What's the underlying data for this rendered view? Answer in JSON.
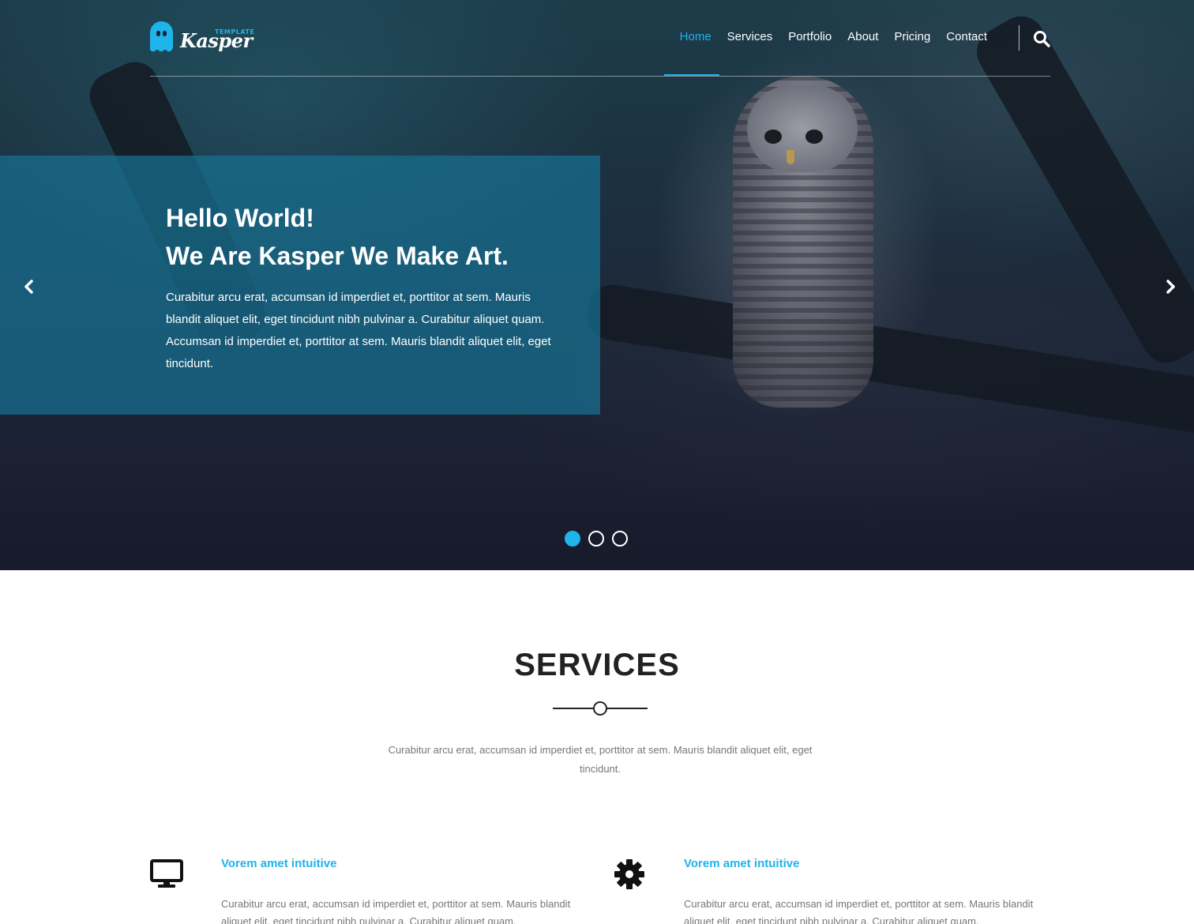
{
  "logo": {
    "small": "TEMPLATE",
    "word": "Kasper"
  },
  "nav": {
    "items": [
      "Home",
      "Services",
      "Portfolio",
      "About",
      "Pricing",
      "Contact"
    ],
    "active": "Home"
  },
  "icons": {
    "search": "search-icon",
    "prev": "chevron-left-icon",
    "next": "chevron-right-icon",
    "service1": "desktop-icon",
    "service2": "gear-icon"
  },
  "colors": {
    "accent": "#1fb4ea",
    "hero_box": "#187091",
    "heading": "#222222",
    "body_text": "#777777"
  },
  "hero": {
    "title": "Hello World!\nWe Are Kasper We Make Art.",
    "text": "Curabitur arcu erat, accumsan id imperdiet et, porttitor at sem. Mauris blandit aliquet elit, eget tincidunt nibh pulvinar a. Curabitur aliquet quam. Accumsan id imperdiet et, porttitor at sem. Mauris blandit aliquet elit, eget tincidunt.",
    "slides": 3,
    "active_slide": 1
  },
  "services": {
    "title": "SERVICES",
    "intro": "Curabitur arcu erat, accumsan id imperdiet et, porttitor at sem. Mauris blandit aliquet elit, eget tincidunt.",
    "items": [
      {
        "icon": "desktop-icon",
        "title": "Vorem amet intuitive",
        "text": "Curabitur arcu erat, accumsan id imperdiet et, porttitor at sem. Mauris blandit aliquet elit, eget tincidunt nibh pulvinar a. Curabitur aliquet quam."
      },
      {
        "icon": "gear-icon",
        "title": "Vorem amet intuitive",
        "text": "Curabitur arcu erat, accumsan id imperdiet et, porttitor at sem. Mauris blandit aliquet elit, eget tincidunt nibh pulvinar a. Curabitur aliquet quam."
      }
    ]
  }
}
